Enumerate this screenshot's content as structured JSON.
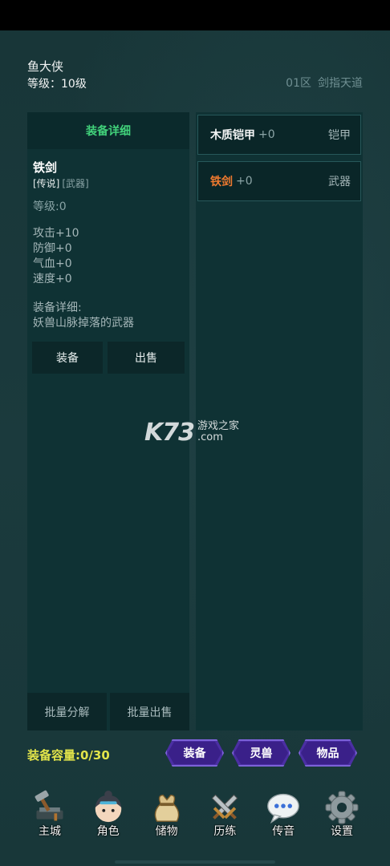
{
  "player": {
    "name": "鱼大侠",
    "level": "等级：10级"
  },
  "server": {
    "zone": "01区",
    "name": "剑指天道"
  },
  "detail": {
    "header": "装备详细",
    "item_name": "铁剑",
    "tag_rarity": "[传说]",
    "tag_type": "[武器]",
    "item_level": "等级:0",
    "stats": [
      "攻击+10",
      "防御+0",
      "气血+0",
      "速度+0"
    ],
    "desc_title": "装备详细:",
    "desc_text": "妖兽山脉掉落的武器",
    "equip_button": "装备",
    "sell_button": "出售",
    "bulk_decompose": "批量分解",
    "bulk_sell": "批量出售"
  },
  "list": [
    {
      "name": "木质铠甲",
      "plus": "+0",
      "type": "铠甲",
      "color": "#f2f4f4"
    },
    {
      "name": "铁剑",
      "plus": "+0",
      "type": "武器",
      "color": "#f07a2f"
    }
  ],
  "watermark": {
    "big": "K73",
    "cn": "游戏之家",
    "dom": ".com"
  },
  "capacity": "装备容量:0/30",
  "tabs": [
    "装备",
    "灵兽",
    "物品"
  ],
  "nav": [
    {
      "label": "主城",
      "icon": "hammer-anvil-icon"
    },
    {
      "label": "角色",
      "icon": "character-face-icon"
    },
    {
      "label": "储物",
      "icon": "sack-icon"
    },
    {
      "label": "历练",
      "icon": "crossed-swords-icon"
    },
    {
      "label": "传音",
      "icon": "chat-bubble-icon"
    },
    {
      "label": "设置",
      "icon": "gear-icon"
    }
  ],
  "colors": {
    "background": "#173437",
    "panel": "#0f3234",
    "green_title": "#41d17a",
    "orange_item": "#f07a2f",
    "capacity_yellow": "#e2e44a",
    "tab_purple": "#4b2fa3"
  }
}
